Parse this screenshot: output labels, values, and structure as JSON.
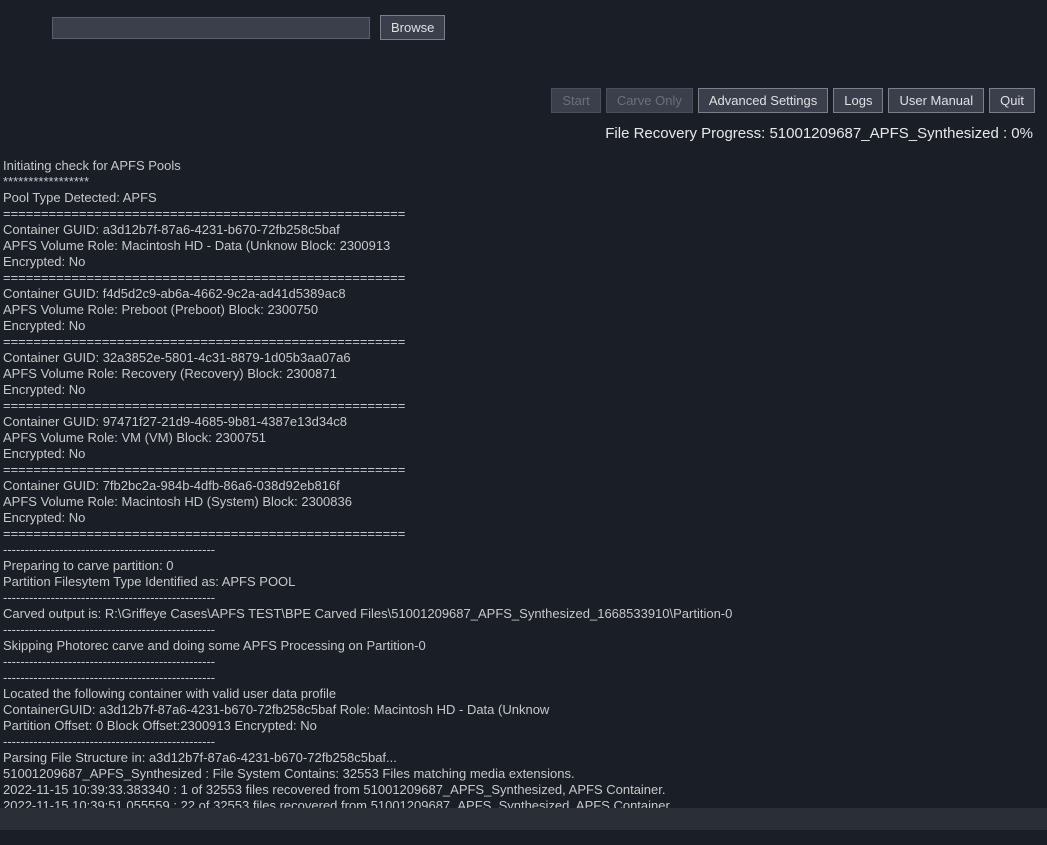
{
  "input": {
    "value": "",
    "placeholder": ""
  },
  "buttons": {
    "browse": "Browse",
    "start": "Start",
    "carve_only": "Carve Only",
    "advanced": "Advanced Settings",
    "logs": "Logs",
    "user_manual": "User Manual",
    "quit": "Quit"
  },
  "progress": {
    "label": "File Recovery Progress: 51001209687_APFS_Synthesized : 0%"
  },
  "log": {
    "lines": [
      "Initiating check for APFS Pools",
      "*****************",
      "Pool Type Detected: APFS",
      "=====================================================",
      "Container GUID: a3d12b7f-87a6-4231-b670-72fb258c5baf",
      "APFS Volume Role: Macintosh HD - Data (Unknow Block: 2300913",
      "Encrypted: No",
      "=====================================================",
      "Container GUID: f4d5d2c9-ab6a-4662-9c2a-ad41d5389ac8",
      "APFS Volume Role: Preboot (Preboot) Block: 2300750",
      "Encrypted: No",
      "=====================================================",
      "Container GUID: 32a3852e-5801-4c31-8879-1d05b3aa07a6",
      "APFS Volume Role: Recovery (Recovery) Block: 2300871",
      "Encrypted: No",
      "=====================================================",
      "Container GUID: 97471f27-21d9-4685-9b81-4387e13d34c8",
      "APFS Volume Role: VM (VM) Block: 2300751",
      "Encrypted: No",
      "=====================================================",
      "Container GUID: 7fb2bc2a-984b-4dfb-86a6-038d92eb816f",
      "APFS Volume Role: Macintosh HD (System) Block: 2300836",
      "Encrypted: No",
      "=====================================================",
      "-------------------------------------------------",
      "Preparing to carve partition: 0",
      "Partition Filesytem Type Identified as: APFS POOL",
      "-------------------------------------------------",
      "Carved output is: R:\\Griffeye Cases\\APFS TEST\\BPE Carved Files\\51001209687_APFS_Synthesized_1668533910\\Partition-0",
      "-------------------------------------------------",
      "Skipping Photorec carve and doing some APFS Processing on Partition-0",
      "-------------------------------------------------",
      "-------------------------------------------------",
      "Located the following container with valid user data profile",
      "ContainerGUID: a3d12b7f-87a6-4231-b670-72fb258c5baf Role: Macintosh HD - Data (Unknow",
      "Partition Offset: 0 Block Offset:2300913 Encrypted: No",
      "-------------------------------------------------",
      "Parsing File Structure in: a3d12b7f-87a6-4231-b670-72fb258c5baf...",
      "51001209687_APFS_Synthesized : File System Contains: 32553 Files matching media extensions.",
      "2022-11-15 10:39:33.383340 : 1 of 32553 files recovered from 51001209687_APFS_Synthesized, APFS Container.",
      "2022-11-15 10:39:51.055559 : 22 of 32553 files recovered from 51001209687_APFS_Synthesized, APFS Container."
    ]
  }
}
